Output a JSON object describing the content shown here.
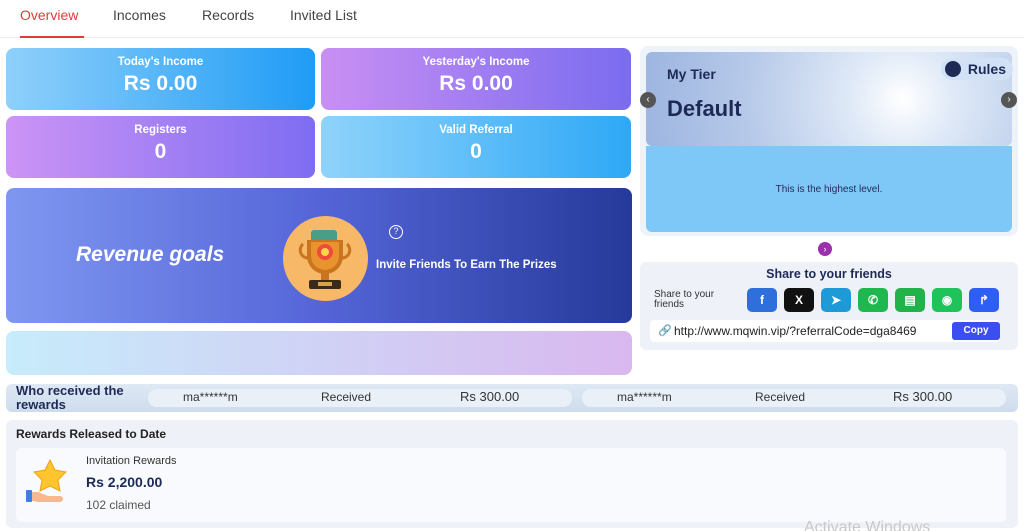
{
  "tabs": [
    "Overview",
    "Incomes",
    "Records",
    "Invited List"
  ],
  "stats": {
    "today_label": "Today's Income",
    "today_value": "Rs  0.00",
    "yesterday_label": "Yesterday's Income",
    "yesterday_value": "Rs  0.00",
    "registers_label": "Registers",
    "registers_value": "0",
    "valid_label": "Valid Referral",
    "valid_value": "0"
  },
  "goals": {
    "title": "Revenue goals",
    "invite": "Invite Friends To Earn The Prizes",
    "question_icon": "?"
  },
  "tier": {
    "label": "My Tier",
    "name": "Default",
    "rules": "Rules",
    "message": "This is the highest level."
  },
  "share": {
    "title": "Share to your friends",
    "subtitle": "Share to your friends",
    "buttons": [
      {
        "icon": "facebook-icon",
        "glyph": "f",
        "color": "#2f6fdb"
      },
      {
        "icon": "x-icon",
        "glyph": "X",
        "color": "#111111"
      },
      {
        "icon": "telegram-icon",
        "glyph": "➤",
        "color": "#1e9ad6"
      },
      {
        "icon": "whatsapp-icon",
        "glyph": "✆",
        "color": "#1fb84f"
      },
      {
        "icon": "sms-icon",
        "glyph": "▤",
        "color": "#22b24a"
      },
      {
        "icon": "line-icon",
        "glyph": "◉",
        "color": "#1fc35a"
      },
      {
        "icon": "share-forward-icon",
        "glyph": "↱",
        "color": "#2d5ff5"
      }
    ],
    "url": "http://www.mqwin.vip/?referralCode=dga8469",
    "copy_label": "Copy"
  },
  "received": {
    "label": "Who received the rewards",
    "items": [
      {
        "user": "ma******m",
        "status": "Received",
        "amount": "Rs  300.00"
      },
      {
        "user": "ma******m",
        "status": "Received",
        "amount": "Rs  300.00"
      }
    ]
  },
  "released": {
    "title": "Rewards Released to Date",
    "name": "Invitation Rewards",
    "amount": "Rs  2,200.00",
    "claimed": "102 claimed"
  },
  "watermark": "Activate Windows"
}
